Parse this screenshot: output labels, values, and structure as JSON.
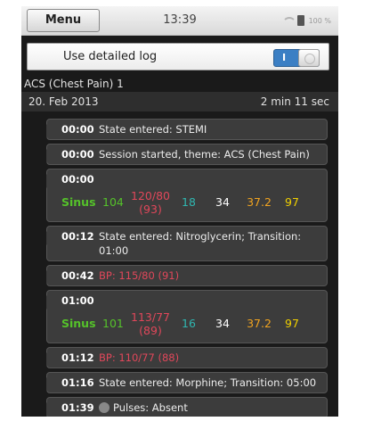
{
  "statusbar": {
    "menu_label": "Menu",
    "time": "13:39",
    "battery": "100 %"
  },
  "settings": {
    "detailed_log_label": "Use detailed log",
    "toggle_state": "I"
  },
  "session": {
    "title": "ACS (Chest Pain) 1",
    "date": "20. Feb 2013",
    "duration": "2 min 11 sec"
  },
  "log": [
    {
      "time": "00:00",
      "text": "State entered: STEMI"
    },
    {
      "time": "00:00",
      "text": "Session started, theme: ACS (Chest Pain)"
    },
    {
      "time": "00:00",
      "rhythm": "Sinus",
      "hr": "104",
      "bp": "120/80",
      "map": "(93)",
      "rr": "18",
      "spo2": "34",
      "temp": "37.2",
      "etco2": "97"
    },
    {
      "time": "00:12",
      "text": "State entered: Nitroglycerin; Transition: 01:00"
    },
    {
      "time": "00:42",
      "text": "BP: 115/80 (91)"
    },
    {
      "time": "01:00",
      "rhythm": "Sinus",
      "hr": "101",
      "bp": "113/77",
      "map": "(89)",
      "rr": "16",
      "spo2": "34",
      "temp": "37.2",
      "etco2": "97"
    },
    {
      "time": "01:12",
      "text": "BP: 110/77 (88)"
    },
    {
      "time": "01:16",
      "text": "State entered: Morphine; Transition: 05:00"
    },
    {
      "time": "01:39",
      "text": "Pulses: Absent"
    }
  ],
  "colors": {
    "rhythm": "#55c22a",
    "bp": "#e0475a",
    "rr": "#2fb6b0",
    "spo2": "#ffffff",
    "temp": "#f0a320",
    "etco2": "#f0d000",
    "toggle": "#3b7fc4"
  }
}
